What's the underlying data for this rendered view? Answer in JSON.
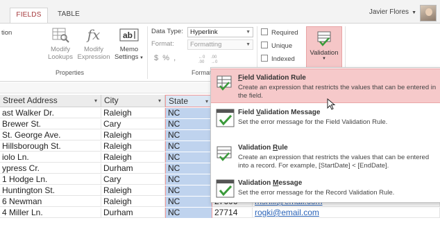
{
  "tabs": [
    {
      "label": "FIELDS",
      "active": true
    },
    {
      "label": "TABLE",
      "active": false
    }
  ],
  "user": {
    "name": "Javier Flores"
  },
  "ribbon": {
    "partial_left_label": "tion",
    "properties_group": {
      "label": "Properties",
      "modify_lookups": [
        "Modify",
        "Lookups"
      ],
      "modify_expression": [
        "Modify",
        "Expression"
      ],
      "memo_settings": [
        "Memo",
        "Settings"
      ]
    },
    "formatting_group": {
      "label": "Formatt",
      "data_type_label": "Data Type:",
      "data_type_value": "Hyperlink",
      "format_label": "Format:",
      "format_value": "Formatting",
      "number_symbols": [
        "$",
        "%",
        ","
      ]
    },
    "validation_group": {
      "required": "Required",
      "unique": "Unique",
      "indexed": "Indexed",
      "validation_button": "Validation"
    }
  },
  "table": {
    "columns": [
      "Street Address",
      "City",
      "State"
    ],
    "rows": [
      {
        "street": "ast Walker Dr.",
        "city": "Raleigh",
        "state": "NC",
        "zip": "",
        "email": ""
      },
      {
        "street": " Brewer St.",
        "city": "Cary",
        "state": "NC",
        "zip": "",
        "email": ""
      },
      {
        "street": " St. George Ave.",
        "city": "Raleigh",
        "state": "NC",
        "zip": "",
        "email": ""
      },
      {
        "street": "Hillsborough St.",
        "city": "Raleigh",
        "state": "NC",
        "zip": "",
        "email": ""
      },
      {
        "street": "iolo Ln.",
        "city": "Raleigh",
        "state": "NC",
        "zip": "",
        "email": ""
      },
      {
        "street": "ypress Cr.",
        "city": "Durham",
        "state": "NC",
        "zip": "",
        "email": ""
      },
      {
        "street": " 1 Hodge Ln.",
        "city": "Cary",
        "state": "NC",
        "zip": "",
        "email": ""
      },
      {
        "street": " Huntington St.",
        "city": "Raleigh",
        "state": "NC",
        "zip": "",
        "email": ""
      },
      {
        "street": " 6 Newman",
        "city": "Raleigh",
        "state": "NC",
        "zip": "27606",
        "email": "mshill@email.com"
      },
      {
        "street": " 4 Miller Ln.",
        "city": "Durham",
        "state": "NC",
        "zip": "27714",
        "email": "rogki@email.com"
      }
    ]
  },
  "menu": {
    "items": [
      {
        "title_pre": "",
        "title_key": "F",
        "title_post": "ield Validation Rule",
        "desc": "Create an expression that restricts the values that can be entered in the field.",
        "highlighted": true
      },
      {
        "title_pre": "Field ",
        "title_key": "V",
        "title_post": "alidation Message",
        "desc": "Set the error message for the Field Validation Rule.",
        "highlighted": false
      },
      {
        "title_pre": "Validation ",
        "title_key": "R",
        "title_post": "ule",
        "desc": "Create an expression that restricts the values that can be entered into a record.  For example, [StartDate] < [EndDate].",
        "highlighted": false
      },
      {
        "title_pre": "Validation ",
        "title_key": "M",
        "title_post": "essage",
        "desc": "Set the error message for the Record Validation Rule.",
        "highlighted": false
      }
    ]
  },
  "colors": {
    "accent": "#a4373a",
    "highlight": "#f6c9ca",
    "selected_column": "#bfd3ee",
    "link": "#2a63b8"
  }
}
